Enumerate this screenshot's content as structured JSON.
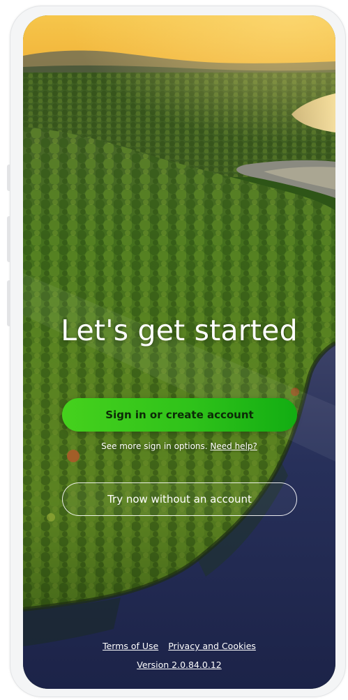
{
  "welcome": {
    "title": "Let's get started",
    "sign_in_label": "Sign in or create account",
    "more_options_text": "See more sign in options.",
    "need_help_label": "Need help?",
    "try_without_account_label": "Try now without an account"
  },
  "footer": {
    "terms_label": "Terms of Use",
    "privacy_label": "Privacy and Cookies",
    "version_text": "Version 2.0.84.0.12"
  },
  "colors": {
    "primary_button": "#2fc21a",
    "primary_button_text": "#0c2a07",
    "sky": "#f2b536",
    "water": "#232a4f",
    "forest": "#3e6a1c"
  },
  "background": {
    "icon": "forest-lake-aerial-photo"
  }
}
